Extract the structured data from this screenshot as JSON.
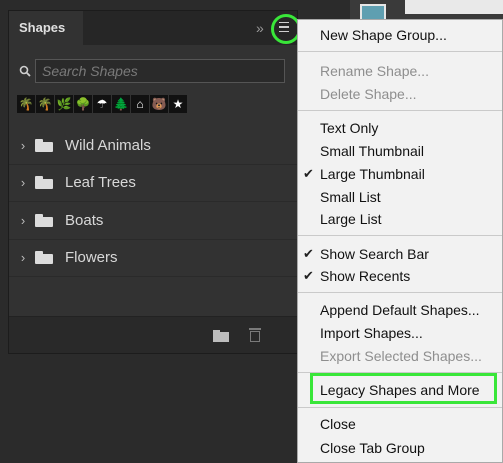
{
  "panel": {
    "tab_label": "Shapes",
    "collapse_glyph": "»",
    "search_placeholder": "Search Shapes",
    "recent_shape_glyphs": [
      "🌴",
      "🌴",
      "🌿",
      "🌳",
      "☂",
      "🌲",
      "⌂",
      "🐻",
      "★"
    ],
    "groups": [
      {
        "label": "Wild Animals"
      },
      {
        "label": "Leaf Trees"
      },
      {
        "label": "Boats"
      },
      {
        "label": "Flowers"
      }
    ]
  },
  "menu": {
    "new_shape_group": "New Shape Group...",
    "rename_shape": "Rename Shape...",
    "delete_shape": "Delete Shape...",
    "text_only": "Text Only",
    "small_thumbnail": "Small Thumbnail",
    "large_thumbnail": "Large Thumbnail",
    "small_list": "Small List",
    "large_list": "Large List",
    "show_search_bar": "Show Search Bar",
    "show_recents": "Show Recents",
    "append_default_shapes": "Append Default Shapes...",
    "import_shapes": "Import Shapes...",
    "export_selected_shapes": "Export Selected Shapes...",
    "legacy_shapes": "Legacy Shapes and More",
    "close": "Close",
    "close_tab_group": "Close Tab Group",
    "checkmark": "✔"
  },
  "colors": {
    "highlight": "#39e639",
    "swatch": "#5f9fb1"
  }
}
